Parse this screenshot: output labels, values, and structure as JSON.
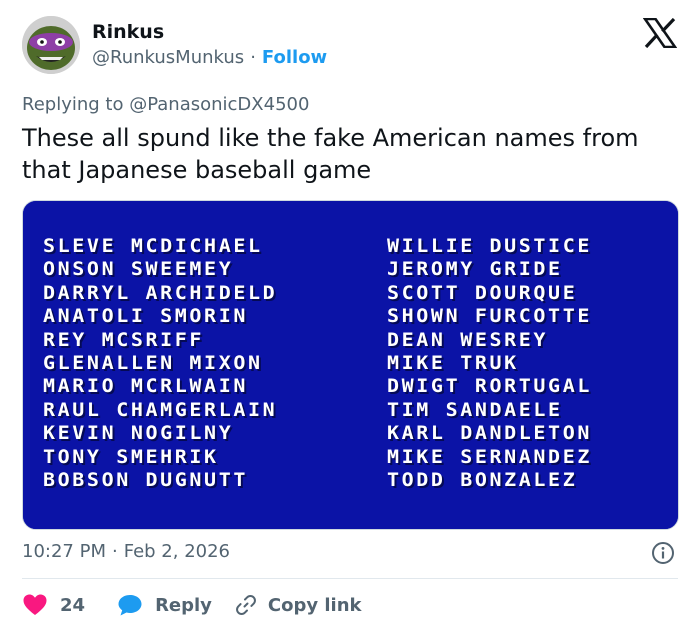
{
  "author": {
    "name": "Rinkus",
    "handle": "@RunkusMunkus",
    "separator": "·",
    "follow_label": "Follow"
  },
  "reply": {
    "prefix": "Replying to",
    "mention": "@PanasonicDX4500"
  },
  "tweet": {
    "text": "These all spund like the fake American names from that Japanese baseball game"
  },
  "media": {
    "left_names": [
      "SLEVE MCDICHAEL",
      "ONSON SWEEMEY",
      "DARRYL ARCHIDELD",
      "ANATOLI SMORIN",
      "REY MCSRIFF",
      "GLENALLEN MIXON",
      "MARIO MCRLWAIN",
      "RAUL CHAMGERLAIN",
      "KEVIN NOGILNY",
      "TONY SMEHRIK",
      "BOBSON DUGNUTT"
    ],
    "right_names": [
      "WILLIE DUSTICE",
      "JEROMY GRIDE",
      "SCOTT DOURQUE",
      "SHOWN FURCOTTE",
      "DEAN WESREY",
      "MIKE TRUK",
      "DWIGT RORTUGAL",
      "TIM SANDAELE",
      "KARL DANDLETON",
      "MIKE SERNANDEZ",
      "TODD BONZALEZ"
    ]
  },
  "meta": {
    "time": "10:27 PM",
    "separator": "·",
    "date": "Feb 2, 2026"
  },
  "actions": {
    "like_count": "24",
    "reply_label": "Reply",
    "copy_label": "Copy link"
  },
  "colors": {
    "accent": "#1d9bf0",
    "like": "#f91880",
    "muted": "#536471",
    "screen_bg": "#0b13a6"
  },
  "icons": {
    "brand": "x-logo-icon",
    "like": "heart-icon",
    "reply": "speech-bubble-icon",
    "copy": "link-icon",
    "info": "info-icon"
  }
}
